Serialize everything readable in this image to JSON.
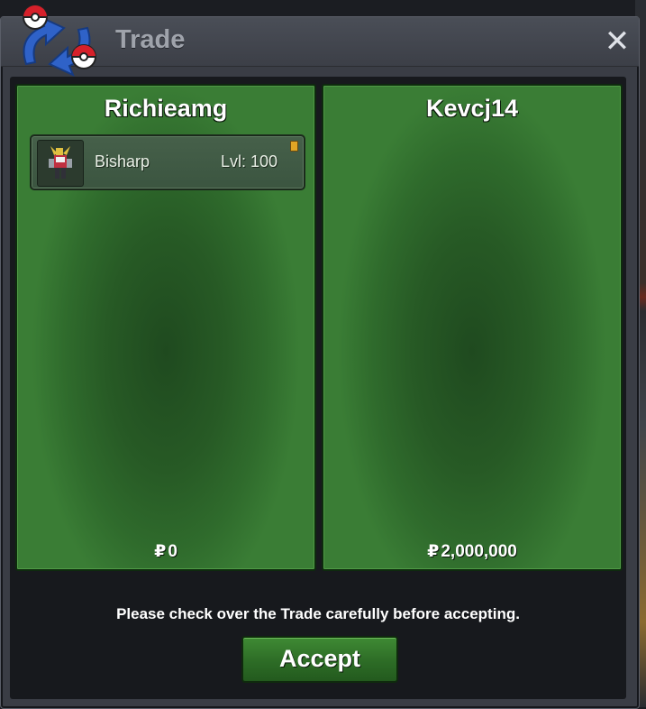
{
  "window": {
    "title": "Trade",
    "close_label": "✕",
    "logo_icon": "trade-swap-icon"
  },
  "left_panel": {
    "player_name": "Richieamg",
    "items": [
      {
        "name": "Bisharp",
        "level": "Lvl: 100",
        "icon": "bisharp-sprite-icon"
      }
    ],
    "currency_symbol": "₽",
    "money": "0"
  },
  "right_panel": {
    "player_name": "Kevcj14",
    "items": [],
    "currency_symbol": "₽",
    "money": "2,000,000"
  },
  "footer": {
    "notice": "Please check over the Trade carefully before accepting.",
    "accept_label": "Accept"
  },
  "colors": {
    "panel_green": "#2f6b2c",
    "accept_green": "#3f8a34",
    "window_bg": "#3a3d45"
  }
}
